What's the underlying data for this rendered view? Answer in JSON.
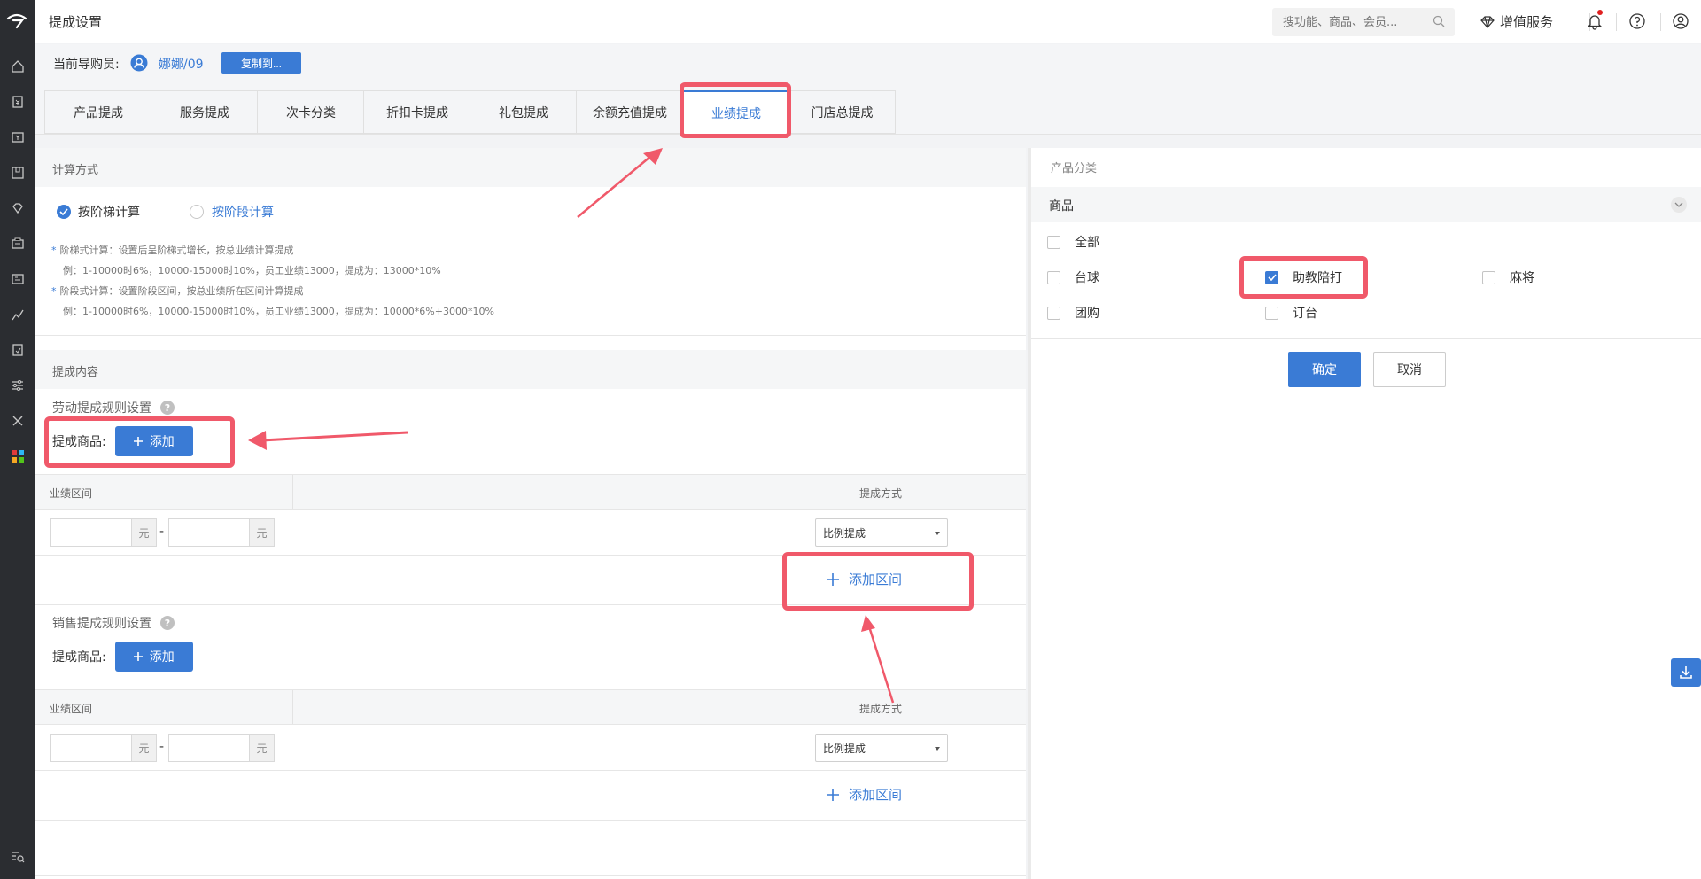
{
  "header": {
    "title": "提成设置",
    "search_placeholder": "搜功能、商品、会员...",
    "value_added": "增值服务"
  },
  "guide": {
    "label": "当前导购员:",
    "name": "娜娜/09",
    "copy_button": "复制到..."
  },
  "tabs": [
    "产品提成",
    "服务提成",
    "次卡分类",
    "折扣卡提成",
    "礼包提成",
    "余额充值提成",
    "业绩提成",
    "门店总提成"
  ],
  "active_tab": "业绩提成",
  "calc": {
    "section_title": "计算方式",
    "option_tier": "按阶梯计算",
    "option_stage": "按阶段计算",
    "note1": "阶梯式计算：设置后呈阶梯式增长，按总业绩计算提成",
    "note1_example": "例：1-10000时6%，10000-15000时10%，员工业绩13000，提成为：13000*10%",
    "note2": "阶段式计算：设置阶段区间，按总业绩所在区间计算提成",
    "note2_example": "例：1-10000时6%，10000-15000时10%，员工业绩13000，提成为：10000*6%+3000*10%"
  },
  "content": {
    "section_title": "提成内容",
    "labor_title": "劳动提成规则设置",
    "sales_title": "销售提成规则设置",
    "goods_label": "提成商品:",
    "add_button": "添加",
    "col_range": "业绩区间",
    "col_method": "提成方式",
    "unit": "元",
    "dash": "-",
    "method_value": "比例提成",
    "add_range": "添加区间"
  },
  "product_panel": {
    "title": "产品分类",
    "group": "商品",
    "items": [
      {
        "label": "全部",
        "checked": false
      },
      {
        "label": "台球",
        "checked": false
      },
      {
        "label": "助教陪打",
        "checked": true
      },
      {
        "label": "麻将",
        "checked": false
      },
      {
        "label": "团购",
        "checked": false
      },
      {
        "label": "订台",
        "checked": false
      }
    ],
    "ok": "确定",
    "cancel": "取消"
  },
  "colors": {
    "accent": "#3a7bd5",
    "annotation": "#f0596a",
    "sidebar": "#2b2d31"
  }
}
